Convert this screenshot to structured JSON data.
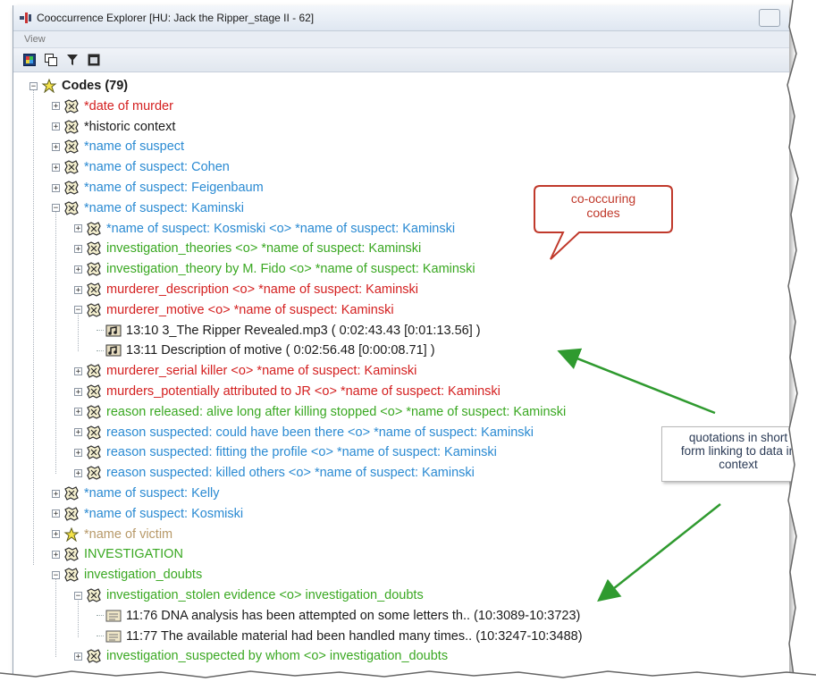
{
  "window": {
    "title": "Cooccurrence Explorer  [HU: Jack the Ripper_stage II - 62]"
  },
  "menu": {
    "items": [
      "View"
    ]
  },
  "colors": {
    "red": "#d42020",
    "black": "#1a1a1a",
    "blue": "#2a8ad2",
    "green": "#3aa822",
    "tan": "#b89a6a"
  },
  "tree": {
    "rows": [
      {
        "label": "Codes (79)",
        "color": "black",
        "bold": true,
        "indent": 0,
        "expander": "minus",
        "icon": "code-family-icon"
      },
      {
        "label": "*date of murder",
        "color": "red",
        "indent": 1,
        "expander": "plus",
        "icon": "code-icon"
      },
      {
        "label": "*historic context",
        "color": "black",
        "indent": 1,
        "expander": "plus",
        "icon": "code-icon"
      },
      {
        "label": "*name of suspect",
        "color": "blue",
        "indent": 1,
        "expander": "plus",
        "icon": "code-icon"
      },
      {
        "label": "*name of suspect: Cohen",
        "color": "blue",
        "indent": 1,
        "expander": "plus",
        "icon": "code-icon"
      },
      {
        "label": "*name of suspect: Feigenbaum",
        "color": "blue",
        "indent": 1,
        "expander": "plus",
        "icon": "code-icon"
      },
      {
        "label": "*name of suspect: Kaminski",
        "color": "blue",
        "indent": 1,
        "expander": "minus",
        "icon": "code-icon"
      },
      {
        "label": "*name of suspect: Kosmiski <o> *name of suspect: Kaminski",
        "color": "blue",
        "indent": 2,
        "expander": "plus",
        "icon": "code-icon"
      },
      {
        "label": "investigation_theories <o> *name of suspect: Kaminski",
        "color": "green",
        "indent": 2,
        "expander": "plus",
        "icon": "code-icon"
      },
      {
        "label": "investigation_theory by M. Fido <o> *name of suspect: Kaminski",
        "color": "green",
        "indent": 2,
        "expander": "plus",
        "icon": "code-icon"
      },
      {
        "label": "murderer_description <o> *name of suspect: Kaminski",
        "color": "red",
        "indent": 2,
        "expander": "plus",
        "icon": "code-icon"
      },
      {
        "label": "murderer_motive <o> *name of suspect: Kaminski",
        "color": "red",
        "indent": 2,
        "expander": "minus",
        "icon": "code-icon"
      },
      {
        "label": "13:10 3_The Ripper Revealed.mp3 ( 0:02:43.43 [0:01:13.56] )",
        "color": "black",
        "indent": 3,
        "expander": "none",
        "icon": "audio-quotation-icon"
      },
      {
        "label": "13:11 Description of motive ( 0:02:56.48 [0:00:08.71] )",
        "color": "black",
        "indent": 3,
        "expander": "none",
        "icon": "audio-quotation-icon"
      },
      {
        "label": "murderer_serial killer <o> *name of suspect: Kaminski",
        "color": "red",
        "indent": 2,
        "expander": "plus",
        "icon": "code-icon"
      },
      {
        "label": "murders_potentially attributed to JR <o> *name of suspect: Kaminski",
        "color": "red",
        "indent": 2,
        "expander": "plus",
        "icon": "code-icon"
      },
      {
        "label": "reason released: alive long after killing stopped <o> *name of suspect: Kaminski",
        "color": "green",
        "indent": 2,
        "expander": "plus",
        "icon": "code-icon"
      },
      {
        "label": "reason suspected: could have been there <o> *name of suspect: Kaminski",
        "color": "blue",
        "indent": 2,
        "expander": "plus",
        "icon": "code-icon"
      },
      {
        "label": "reason suspected: fitting the profile <o> *name of suspect: Kaminski",
        "color": "blue",
        "indent": 2,
        "expander": "plus",
        "icon": "code-icon"
      },
      {
        "label": "reason suspected: killed others <o> *name of suspect: Kaminski",
        "color": "blue",
        "indent": 2,
        "expander": "plus",
        "icon": "code-icon"
      },
      {
        "label": "*name of suspect: Kelly",
        "color": "blue",
        "indent": 1,
        "expander": "plus",
        "icon": "code-icon"
      },
      {
        "label": "*name of suspect: Kosmiski",
        "color": "blue",
        "indent": 1,
        "expander": "plus",
        "icon": "code-icon"
      },
      {
        "label": "*name of victim",
        "color": "tan",
        "indent": 1,
        "expander": "plus",
        "icon": "code-family-icon"
      },
      {
        "label": "INVESTIGATION",
        "color": "green",
        "indent": 1,
        "expander": "plus",
        "icon": "code-icon"
      },
      {
        "label": "investigation_doubts",
        "color": "green",
        "indent": 1,
        "expander": "minus",
        "icon": "code-icon"
      },
      {
        "label": "investigation_stolen evidence <o> investigation_doubts",
        "color": "green",
        "indent": 2,
        "expander": "minus",
        "icon": "code-icon"
      },
      {
        "label": "11:76 DNA analysis has been attempted on some letters th.. (10:3089-10:3723)",
        "color": "black",
        "indent": 3,
        "expander": "none",
        "icon": "text-quotation-icon"
      },
      {
        "label": "11:77 The available material had been handled many times.. (10:3247-10:3488)",
        "color": "black",
        "indent": 3,
        "expander": "none",
        "icon": "text-quotation-icon"
      },
      {
        "label": "investigation_suspected by whom <o> investigation_doubts",
        "color": "green",
        "indent": 2,
        "expander": "plus",
        "icon": "code-icon"
      }
    ]
  },
  "annotations": {
    "cooccurring": [
      "co-occuring",
      "codes"
    ],
    "quotations": [
      "quotations in short",
      "form linking to data in",
      "context"
    ]
  }
}
